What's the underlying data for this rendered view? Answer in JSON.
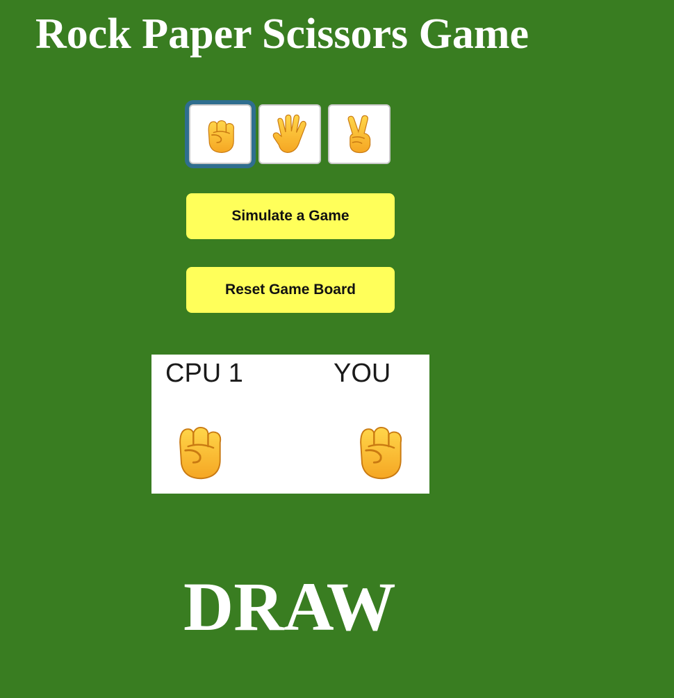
{
  "page": {
    "title": "Rock Paper Scissors Game",
    "background_color": "#397d21"
  },
  "choices": [
    {
      "name": "rock",
      "icon": "raised-fist-icon",
      "selected": true
    },
    {
      "name": "paper",
      "icon": "raised-hand-icon",
      "selected": false
    },
    {
      "name": "scissors",
      "icon": "victory-hand-icon",
      "selected": false
    }
  ],
  "buttons": {
    "simulate_label": "Simulate a Game",
    "reset_label": "Reset Game Board",
    "color": "#ffff5a"
  },
  "board": {
    "cpu_label": "CPU 1",
    "you_label": "YOU",
    "cpu_choice_icon": "raised-fist-icon",
    "you_choice_icon": "raised-fist-icon"
  },
  "result": {
    "text": "DRAW"
  }
}
